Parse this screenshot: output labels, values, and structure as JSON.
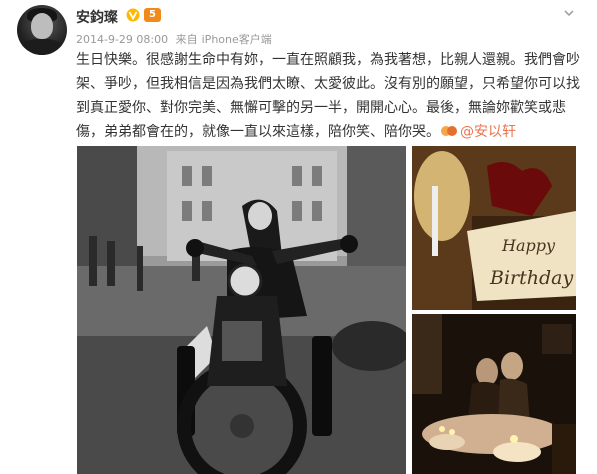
{
  "post": {
    "author": "安鈞璨",
    "verified_icon": "v-badge-icon",
    "member_icon": "crown-icon",
    "member_level": "5",
    "time": "2014-9-29 08:00",
    "source_prefix": "来自",
    "source": "iPhone客户端",
    "text": "生日快樂。很感謝生命中有妳，一直在照顧我，為我著想，比親人還親。我們會吵架、爭吵，但我相信是因為我們太瞭、太愛彼此。沒有別的願望，只希望你可以找到真正愛你、對你完美、無懈可擊的另一半，開開心心。最後，無論妳歡笑或悲傷，弟弟都會在的，就像一直以來這樣，陪你笑、陪你哭。",
    "mention": "@安以轩",
    "menu_icon": "chevron-down-icon"
  },
  "images": {
    "main_alt": "motorcycle-photo",
    "cake_text_line1": "Happy",
    "cake_text_line2": "Birthday",
    "couple_alt": "couple-photo"
  }
}
